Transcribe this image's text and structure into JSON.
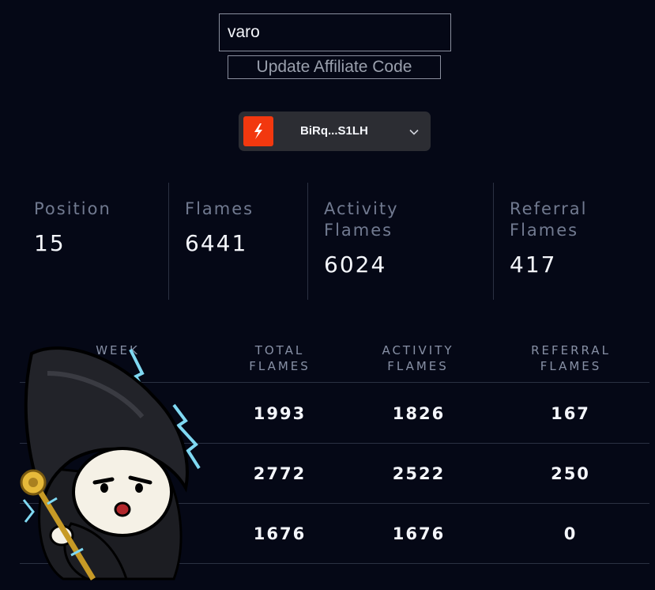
{
  "affiliate": {
    "code_value": "varo",
    "update_label": "Update Affiliate Code"
  },
  "wallet": {
    "address": "BiRq...S1LH",
    "logo_icon": "flame-bolt-icon",
    "chevron_icon": "chevron-down-icon",
    "accent_color": "#f2380f"
  },
  "stats": [
    {
      "label": "Position",
      "value": "15"
    },
    {
      "label": "Flames",
      "value": "6441"
    },
    {
      "label": "Activity Flames",
      "value": "6024"
    },
    {
      "label": "Referral Flames",
      "value": "417"
    }
  ],
  "table": {
    "headers": [
      "WEEK",
      "TOTAL FLAMES",
      "ACTIVITY FLAMES",
      "REFERRAL FLAMES"
    ],
    "rows": [
      {
        "week": "",
        "total": "1993",
        "activity": "1826",
        "referral": "167"
      },
      {
        "week": "",
        "total": "2772",
        "activity": "2522",
        "referral": "250"
      },
      {
        "week": "",
        "total": "1676",
        "activity": "1676",
        "referral": "0"
      }
    ]
  },
  "mascot": {
    "icon": "reaper-mascot-icon"
  }
}
